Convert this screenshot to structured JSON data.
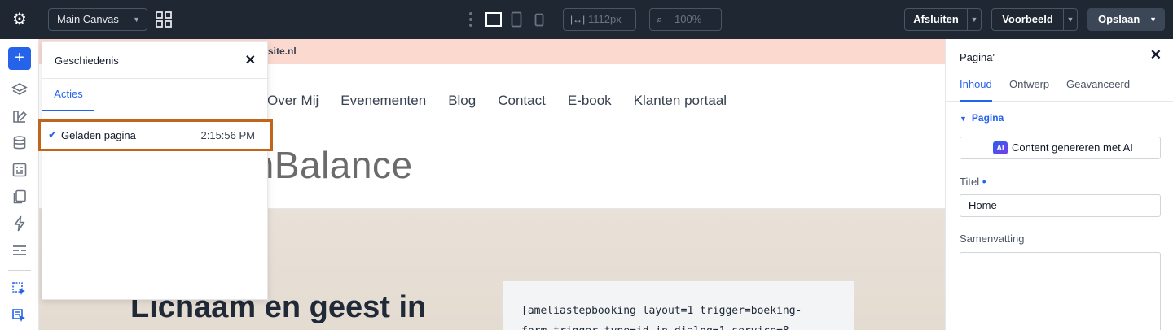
{
  "toolbar": {
    "canvas_select": "Main Canvas",
    "width_value": "1112px",
    "zoom_value": "100%",
    "close_label": "Afsluiten",
    "preview_label": "Voorbeeld",
    "save_label": "Opslaan"
  },
  "website": {
    "promo_text": "site.nl",
    "nav": [
      "Over Mij",
      "Evenementen",
      "Blog",
      "Contact",
      "E-book",
      "Klanten portaal"
    ],
    "logo_text": "mBalance",
    "hero_title": "Lichaam en geest in",
    "code_lines": [
      "[ameliastepbooking layout=1 trigger=boeking-",
      "form trigger_type=id in_dialog=1 service=8"
    ]
  },
  "history": {
    "title": "Geschiedenis",
    "tab": "Acties",
    "entries": [
      {
        "label": "Geladen pagina",
        "time": "2:15:56 PM"
      }
    ]
  },
  "right_panel": {
    "title": "Pagina'",
    "tabs": [
      "Inhoud",
      "Ontwerp",
      "Geavanceerd"
    ],
    "section": "Pagina",
    "ai_button": "Content genereren met AI",
    "ai_badge": "AI",
    "title_label": "Titel",
    "title_value": "Home",
    "summary_label": "Samenvatting",
    "summary_value": ""
  },
  "colors": {
    "topbar": "#1f2733",
    "accent": "#2563eb",
    "highlight_border": "#c2651a",
    "promo_bg": "#fbd9cf"
  }
}
